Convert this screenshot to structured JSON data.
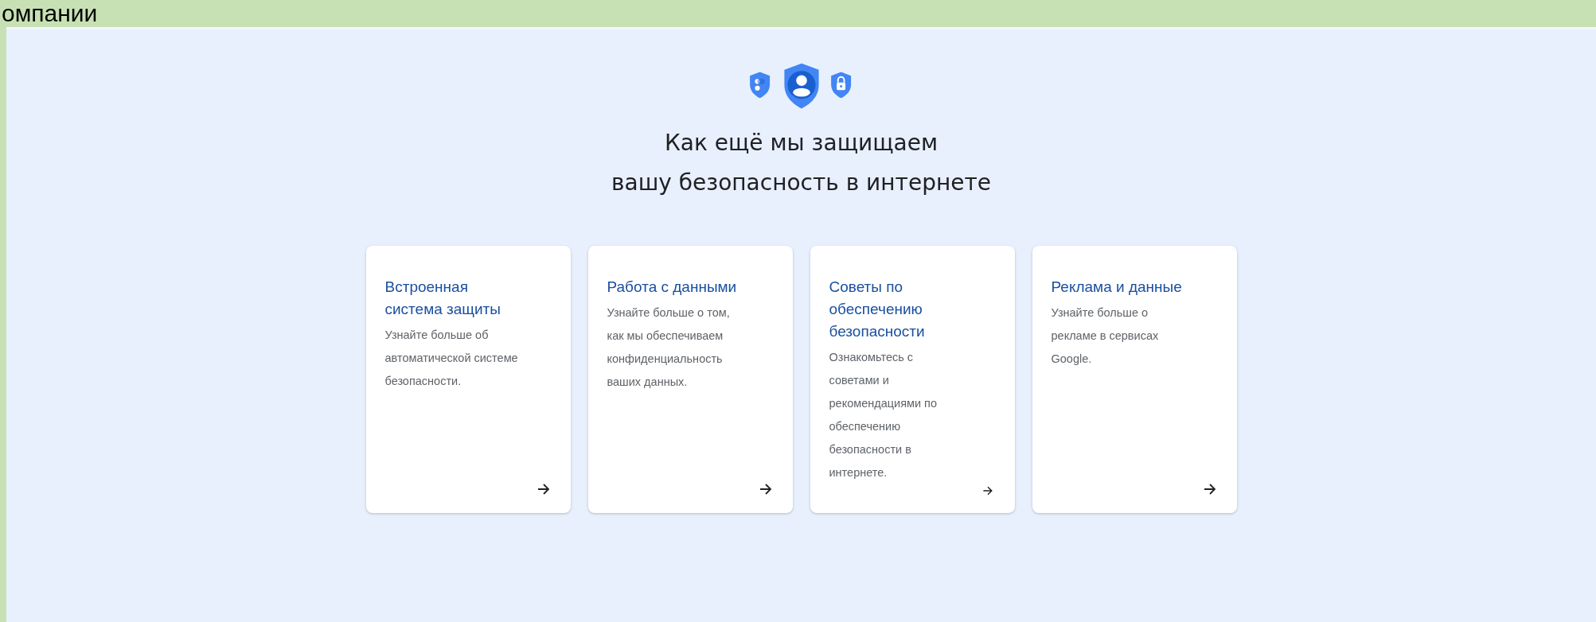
{
  "cut_heading": "омпании",
  "hero": {
    "title": "Как ещё мы защищаем\nвашу безопасность в интернете"
  },
  "cards": [
    {
      "title": "Встроенная\nсистема защиты",
      "text": "Узнайте больше об\nавтоматической системе\nбезопасности."
    },
    {
      "title": "Работа с данными",
      "text": "Узнайте больше о том,\nкак мы обеспечиваем\nконфиденциальность\nваших данных."
    },
    {
      "title": "Советы по\nобеспечению\nбезопасности",
      "text": "Ознакомьтесь с\nсоветами и\nрекомендациями по\nобеспечению\nбезопасности в\nинтернете."
    },
    {
      "title": "Реклама и данные",
      "text": "Узнайте больше о\nрекламе в сервисах\nGoogle."
    }
  ]
}
